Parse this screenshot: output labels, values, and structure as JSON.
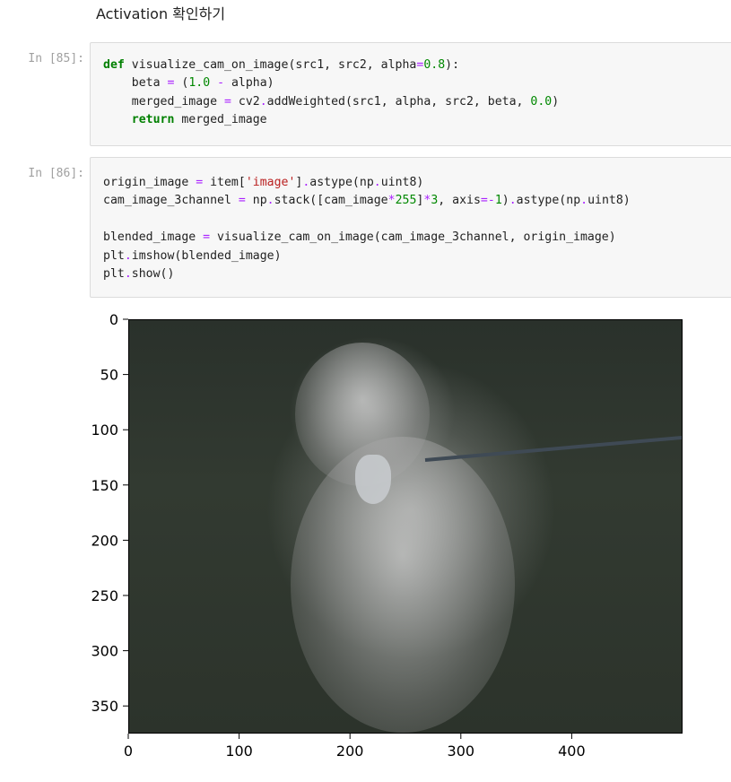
{
  "markdown": {
    "heading": "Activation 확인하기"
  },
  "cells": [
    {
      "prompt": "In [85]:",
      "lines": [
        [
          {
            "t": "def",
            "c": "kw"
          },
          {
            "t": " visualize_cam_on_image(src1, src2, alpha"
          },
          {
            "t": "=",
            "c": "op"
          },
          {
            "t": "0.8",
            "c": "num"
          },
          {
            "t": "):"
          }
        ],
        [
          {
            "t": "    beta "
          },
          {
            "t": "=",
            "c": "op"
          },
          {
            "t": " ("
          },
          {
            "t": "1.0",
            "c": "num"
          },
          {
            "t": " "
          },
          {
            "t": "-",
            "c": "op"
          },
          {
            "t": " alpha)"
          }
        ],
        [
          {
            "t": "    merged_image "
          },
          {
            "t": "=",
            "c": "op"
          },
          {
            "t": " cv2"
          },
          {
            "t": ".",
            "c": "op"
          },
          {
            "t": "addWeighted(src1, alpha, src2, beta, "
          },
          {
            "t": "0.0",
            "c": "num"
          },
          {
            "t": ")"
          }
        ],
        [
          {
            "t": "    "
          },
          {
            "t": "return",
            "c": "kw"
          },
          {
            "t": " merged_image"
          }
        ]
      ]
    },
    {
      "prompt": "In [86]:",
      "lines": [
        [
          {
            "t": "origin_image "
          },
          {
            "t": "=",
            "c": "op"
          },
          {
            "t": " item["
          },
          {
            "t": "'image'",
            "c": "str"
          },
          {
            "t": "]"
          },
          {
            "t": ".",
            "c": "op"
          },
          {
            "t": "astype(np"
          },
          {
            "t": ".",
            "c": "op"
          },
          {
            "t": "uint8)"
          }
        ],
        [
          {
            "t": "cam_image_3channel "
          },
          {
            "t": "=",
            "c": "op"
          },
          {
            "t": " np"
          },
          {
            "t": ".",
            "c": "op"
          },
          {
            "t": "stack([cam_image"
          },
          {
            "t": "*",
            "c": "op"
          },
          {
            "t": "255",
            "c": "num"
          },
          {
            "t": "]"
          },
          {
            "t": "*",
            "c": "op"
          },
          {
            "t": "3",
            "c": "num"
          },
          {
            "t": ", axis"
          },
          {
            "t": "=-",
            "c": "op"
          },
          {
            "t": "1",
            "c": "num"
          },
          {
            "t": ")"
          },
          {
            "t": ".",
            "c": "op"
          },
          {
            "t": "astype(np"
          },
          {
            "t": ".",
            "c": "op"
          },
          {
            "t": "uint8)"
          }
        ],
        [],
        [
          {
            "t": "blended_image "
          },
          {
            "t": "=",
            "c": "op"
          },
          {
            "t": " visualize_cam_on_image(cam_image_3channel, origin_image)"
          }
        ],
        [
          {
            "t": "plt"
          },
          {
            "t": ".",
            "c": "op"
          },
          {
            "t": "imshow(blended_image)"
          }
        ],
        [
          {
            "t": "plt"
          },
          {
            "t": ".",
            "c": "op"
          },
          {
            "t": "show()"
          }
        ]
      ]
    }
  ],
  "output_plot": {
    "image_description_icon": "dog-cam-overlay-image",
    "colors": {
      "axis": "#000000",
      "background": "#2e352e"
    }
  },
  "chart_data": {
    "type": "image",
    "x_ticks": [
      0,
      100,
      200,
      300,
      400
    ],
    "y_ticks": [
      0,
      50,
      100,
      150,
      200,
      250,
      300,
      350
    ],
    "xlim": [
      0,
      500
    ],
    "ylim": [
      375,
      0
    ]
  }
}
